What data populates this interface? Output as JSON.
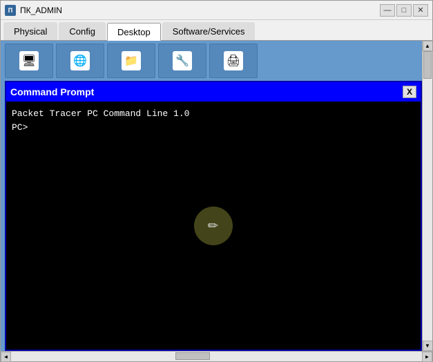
{
  "window": {
    "title": "ПК_ADMIN",
    "icon_text": "П"
  },
  "window_controls": {
    "minimize": "—",
    "maximize": "□",
    "close": "✕"
  },
  "tabs": [
    {
      "id": "physical",
      "label": "Physical",
      "active": false
    },
    {
      "id": "config",
      "label": "Config",
      "active": false
    },
    {
      "id": "desktop",
      "label": "Desktop",
      "active": true
    },
    {
      "id": "software",
      "label": "Software/Services",
      "active": false
    }
  ],
  "cmd_window": {
    "title": "Command Prompt",
    "close_label": "X",
    "body_text": "Packet Tracer PC Command Line 1.0\nPC>"
  },
  "scrollbar": {
    "up_arrow": "▲",
    "down_arrow": "▼",
    "left_arrow": "◄",
    "right_arrow": "►"
  },
  "desktop_icons": [
    {
      "id": "icon1",
      "symbol": "🖥"
    },
    {
      "id": "icon2",
      "symbol": "🌐"
    },
    {
      "id": "icon3",
      "symbol": "📁"
    },
    {
      "id": "icon4",
      "symbol": "🔧"
    },
    {
      "id": "icon5",
      "symbol": "🖨"
    }
  ]
}
